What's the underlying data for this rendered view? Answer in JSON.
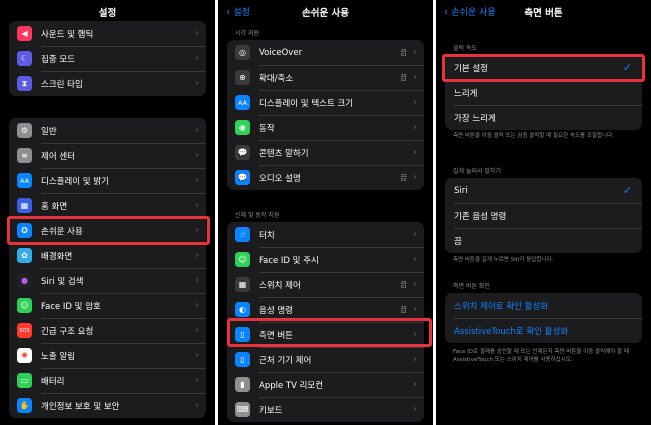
{
  "panel1": {
    "title": "설정",
    "top_items": [
      {
        "label": "사운드 및 햅틱",
        "icon": "speaker-icon",
        "color": "#ff375f"
      },
      {
        "label": "집중 모드",
        "icon": "moon-icon",
        "color": "#5e5ce6"
      },
      {
        "label": "스크린 타임",
        "icon": "hourglass-icon",
        "color": "#5e5ce6"
      }
    ],
    "items": [
      {
        "label": "일반",
        "icon": "gear-icon",
        "color": "#8e8e93"
      },
      {
        "label": "제어 센터",
        "icon": "switches-icon",
        "color": "#8e8e93"
      },
      {
        "label": "디스플레이 및 밝기",
        "icon": "aa-icon",
        "color": "#0a84ff"
      },
      {
        "label": "홈 화면",
        "icon": "grid-icon",
        "color": "#3a5fe5"
      },
      {
        "label": "손쉬운 사용",
        "icon": "accessibility-icon",
        "color": "#0a84ff"
      },
      {
        "label": "배경화면",
        "icon": "flower-icon",
        "color": "#32ade6"
      },
      {
        "label": "Siri 및 검색",
        "icon": "siri-icon",
        "color": "#222"
      },
      {
        "label": "Face ID 및 암호",
        "icon": "faceid-icon",
        "color": "#30d158"
      },
      {
        "label": "긴급 구조 요청",
        "icon": "sos-icon",
        "color": "#ff3b30"
      },
      {
        "label": "노출 알림",
        "icon": "exposure-icon",
        "color": "#ffffff"
      },
      {
        "label": "배터리",
        "icon": "battery-icon",
        "color": "#30d158"
      },
      {
        "label": "개인정보 보호 및 보안",
        "icon": "hand-icon",
        "color": "#0a84ff"
      }
    ]
  },
  "panel2": {
    "back": "설정",
    "title": "손쉬운 사용",
    "section1": "시각 지원",
    "vision": [
      {
        "label": "VoiceOver",
        "value": "끔",
        "icon": "voiceover-icon",
        "color": "#3a3a3c"
      },
      {
        "label": "확대/축소",
        "value": "끔",
        "icon": "zoom-icon",
        "color": "#3a3a3c"
      },
      {
        "label": "디스플레이 및 텍스트 크기",
        "value": "",
        "icon": "aa-icon",
        "color": "#0a84ff"
      },
      {
        "label": "동작",
        "value": "",
        "icon": "motion-icon",
        "color": "#30d158"
      },
      {
        "label": "콘텐츠 말하기",
        "value": "",
        "icon": "speech-bubble-icon",
        "color": "#3a3a3c"
      },
      {
        "label": "오디오 설명",
        "value": "끔",
        "icon": "audio-description-icon",
        "color": "#0a84ff"
      }
    ],
    "section2": "신체 및 동작 지원",
    "physical": [
      {
        "label": "터치",
        "value": "",
        "icon": "touch-icon",
        "color": "#0a84ff"
      },
      {
        "label": "Face ID 및 주시",
        "value": "",
        "icon": "faceid-icon",
        "color": "#30d158"
      },
      {
        "label": "스위치 제어",
        "value": "끔",
        "icon": "switch-control-icon",
        "color": "#3a3a3c"
      },
      {
        "label": "음성 명령",
        "value": "끔",
        "icon": "voice-control-icon",
        "color": "#0a84ff"
      },
      {
        "label": "측면 버튼",
        "value": "",
        "icon": "side-button-icon",
        "color": "#0a84ff"
      },
      {
        "label": "근처 기기 제어",
        "value": "",
        "icon": "nearby-devices-icon",
        "color": "#0a84ff"
      },
      {
        "label": "Apple TV 리모컨",
        "value": "",
        "icon": "remote-icon",
        "color": "#8e8e93"
      },
      {
        "label": "키보드",
        "value": "",
        "icon": "keyboard-icon",
        "color": "#8e8e93"
      }
    ]
  },
  "panel3": {
    "back": "손쉬운 사용",
    "title": "측면 버튼",
    "section1": "클릭 속도",
    "speed": [
      {
        "label": "기본 설정",
        "checked": true
      },
      {
        "label": "느리게",
        "checked": false
      },
      {
        "label": "가장 느리게",
        "checked": false
      }
    ],
    "note1": "측면 버튼을 이중 클릭 또는 삼중 클릭할 때 필요한 속도를 조절합니다.",
    "section2": "길게 눌러서 말하기",
    "hold": [
      {
        "label": "Siri",
        "checked": true
      },
      {
        "label": "기존 음성 명령",
        "checked": false
      },
      {
        "label": "끔",
        "checked": false
      }
    ],
    "note2": "측면 버튼을 길게 누르면 Siri가 응답합니다.",
    "section3": "측면 버튼 확인",
    "confirm": [
      {
        "label": "스위치 제어로 확인 활성화"
      },
      {
        "label": "AssistiveTouch로 확인 활성화"
      }
    ],
    "note3": "Face ID로 결제를 승인할 때 또는 언제든지 측면 버튼을 이중 클릭해야 할 때 AssistiveTouch 또는 스위치 제어를 사용하십시오."
  }
}
